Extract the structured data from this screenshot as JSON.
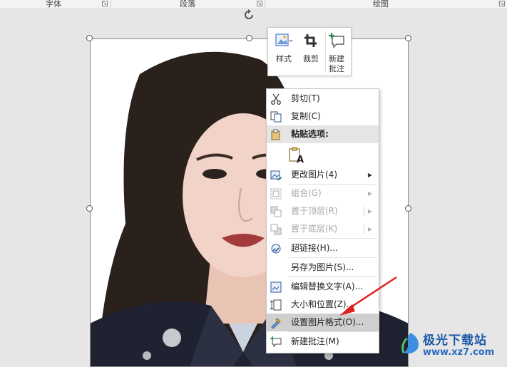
{
  "ribbon": {
    "groups": [
      "字体",
      "段落",
      "绘图"
    ]
  },
  "mini_toolbar": {
    "style_label": "样式",
    "crop_label": "裁剪",
    "new_comment_line1": "新建",
    "new_comment_line2": "批注"
  },
  "context_menu": {
    "cut": "剪切(T)",
    "copy": "复制(C)",
    "paste_options": "粘贴选项:",
    "change_picture": "更改图片(4)",
    "group": "组合(G)",
    "bring_to_front": "置于顶层(R)",
    "send_to_back": "置于底层(K)",
    "hyperlink": "超链接(H)...",
    "save_as_picture": "另存为图片(S)...",
    "edit_alt_text": "编辑替换文字(A)...",
    "size_and_position": "大小和位置(Z)...",
    "format_picture": "设置图片格式(O)...",
    "new_comment": "新建批注(M)"
  },
  "watermark": {
    "title": "极光下载站",
    "url": "www.xz7.com"
  },
  "colors": {
    "accent": "#2b579a",
    "arrow_red": "#e02020",
    "menu_highlight": "#cfcfcf",
    "disabled_text": "#a6a6a6"
  }
}
